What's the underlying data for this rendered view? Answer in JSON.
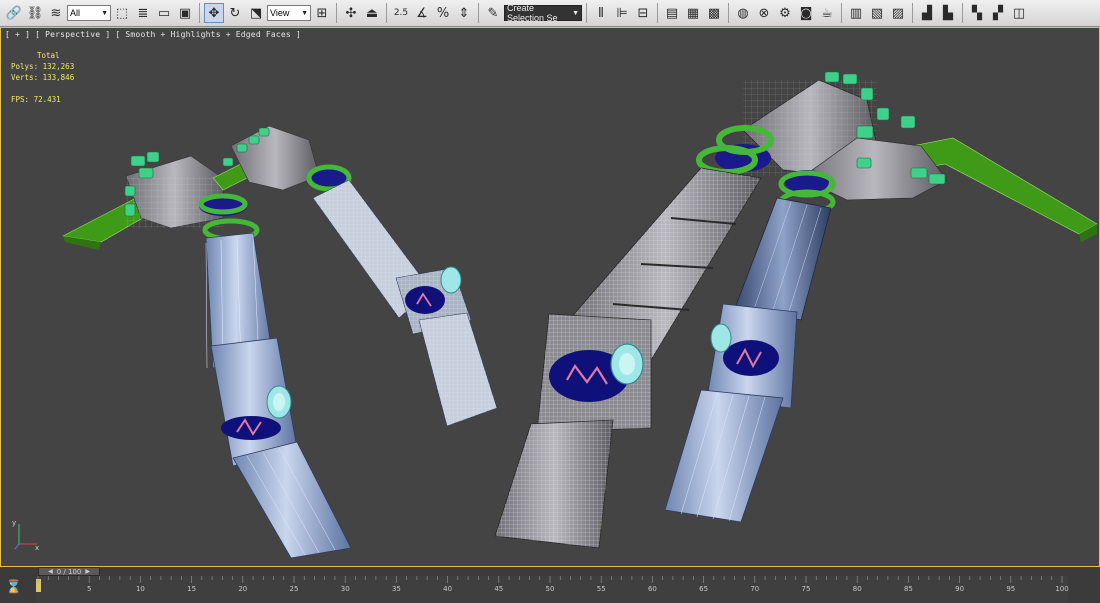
{
  "toolbar": {
    "selection_filter": "All",
    "reference_coordinate": "View",
    "named_selection_placeholder": "Create Selection Se",
    "snap_label": "2.5",
    "angle_snap_label": "%",
    "icons": [
      "link-icon",
      "unlink-icon",
      "bind-spacewarp-icon",
      "select-object-icon",
      "select-by-name-icon",
      "rectangular-selection-icon",
      "window-crossing-icon",
      "move-icon",
      "rotate-icon",
      "scale-icon",
      "pivot-icon",
      "manipulate-icon",
      "snap-icon",
      "angle-snap-icon",
      "percent-snap-icon",
      "spinner-snap-icon",
      "edit-named-selection-icon",
      "mirror-icon",
      "align-icon",
      "layer-manager-icon",
      "graphite-ribbon-icon",
      "curve-editor-icon",
      "schematic-view-icon",
      "material-editor-icon",
      "render-setup-icon",
      "rendered-frame-icon",
      "render-icon"
    ]
  },
  "viewport": {
    "label": "[ + ] [ Perspective ] [ Smooth + Highlights + Edged Faces ]",
    "stats": {
      "header": "Total",
      "polys_label": "Polys:",
      "polys_value": "132,263",
      "verts_label": "Verts:",
      "verts_value": "133,846",
      "fps_label": "FPS:",
      "fps_value": "72.431"
    },
    "axis": {
      "y": "y",
      "x": "x"
    }
  },
  "timeline": {
    "slider_label": "0 / 100",
    "ticks": [
      5,
      10,
      15,
      20,
      25,
      30,
      35,
      40,
      45,
      50,
      55,
      60,
      65,
      70,
      75,
      80,
      85,
      90,
      95,
      100
    ],
    "start": 0,
    "end": 100
  },
  "colors": {
    "viewport_bg": "#444444",
    "arm_blue": "#9fb4d8",
    "arm_grey": "#9a9a9a",
    "hand_green": "#3fd08a",
    "blade_green": "#3f9a18",
    "ring_green": "#45b83a",
    "joint_navy": "#1a1a8a",
    "frame_highlight": "#e2c24a",
    "stats_text": "#f2e86a"
  }
}
